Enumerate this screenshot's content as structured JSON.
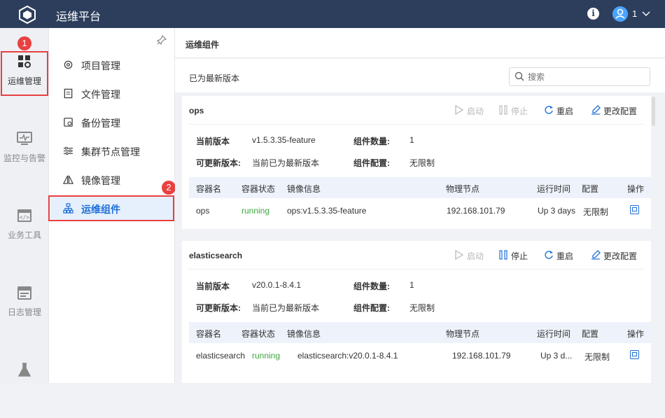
{
  "app": {
    "title": "运维平台",
    "user_name": "1"
  },
  "rail": {
    "items": [
      {
        "label": "运维管理",
        "icon": "grid-gear-icon",
        "active": true
      },
      {
        "label": "监控与告警",
        "icon": "monitor-icon"
      },
      {
        "label": "业务工具",
        "icon": "code-window-icon"
      },
      {
        "label": "日志管理",
        "icon": "calendar-log-icon"
      },
      {
        "label": "",
        "icon": "flask-icon"
      }
    ]
  },
  "annotations": {
    "badge1": "1",
    "badge2": "2"
  },
  "submenu": {
    "items": [
      {
        "label": "项目管理",
        "icon": "settings-gear-icon"
      },
      {
        "label": "文件管理",
        "icon": "document-icon"
      },
      {
        "label": "备份管理",
        "icon": "backup-icon"
      },
      {
        "label": "集群节点管理",
        "icon": "sliders-icon"
      },
      {
        "label": "镜像管理",
        "icon": "mirror-icon"
      },
      {
        "label": "运维组件",
        "icon": "component-tree-icon",
        "active": true
      }
    ]
  },
  "main": {
    "title": "运维组件",
    "status": "已为最新版本",
    "search": {
      "placeholder": "搜索",
      "value": ""
    }
  },
  "actions": {
    "start": "启动",
    "stop": "停止",
    "restart": "重启",
    "config": "更改配置"
  },
  "labels": {
    "current_version": "当前版本",
    "updatable_version": "可更新版本:",
    "component_count": "组件数量:",
    "component_config": "组件配置:"
  },
  "table_headers": [
    "容器名",
    "容器状态",
    "镜像信息",
    "物理节点",
    "运行时间",
    "配置",
    "操作"
  ],
  "cards": [
    {
      "name": "ops",
      "current_version": "v1.5.3.35-feature",
      "updatable": "当前已为最新版本",
      "count": "1",
      "config": "无限制",
      "stop_disabled": true,
      "row": {
        "container": "ops",
        "status": "running",
        "image": "ops:v1.5.3.35-feature",
        "node": "192.168.101.79",
        "uptime": "Up 3 days",
        "config": "无限制"
      }
    },
    {
      "name": "elasticsearch",
      "current_version": "v20.0.1-8.4.1",
      "updatable": "当前已为最新版本",
      "count": "1",
      "config": "无限制",
      "stop_disabled": false,
      "row": {
        "container": "elasticsearch",
        "status": "running",
        "image": "elasticsearch:v20.0.1-8.4.1",
        "node": "192.168.101.79",
        "uptime": "Up 3 d...",
        "config": "无限制"
      }
    }
  ],
  "colors": {
    "topbar": "#2c3e5c",
    "accent": "#1f6fd6",
    "running": "#3fa63f",
    "highlight": "#e94040"
  }
}
